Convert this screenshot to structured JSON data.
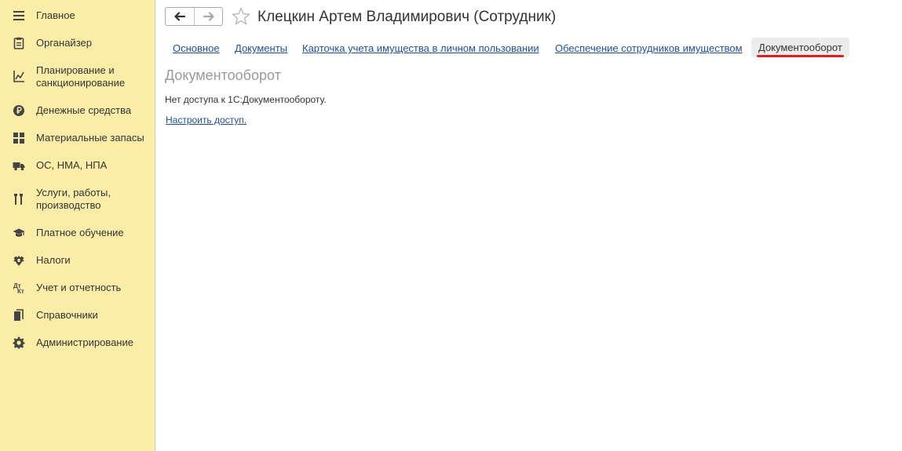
{
  "sidebar": {
    "items": [
      {
        "label": "Главное",
        "icon": "menu-icon"
      },
      {
        "label": "Органайзер",
        "icon": "clipboard-icon"
      },
      {
        "label": "Планирование и санкционирование",
        "icon": "planning-chart-icon"
      },
      {
        "label": "Денежные средства",
        "icon": "ruble-coin-icon"
      },
      {
        "label": "Материальные запасы",
        "icon": "grid-blocks-icon"
      },
      {
        "label": "ОС, НМА, НПА",
        "icon": "truck-icon"
      },
      {
        "label": "Услуги, работы, производство",
        "icon": "tools-icon"
      },
      {
        "label": "Платное обучение",
        "icon": "graduation-cap-icon"
      },
      {
        "label": "Налоги",
        "icon": "emblem-eagle-icon"
      },
      {
        "label": "Учет и отчетность",
        "icon": "debit-credit-icon"
      },
      {
        "label": "Справочники",
        "icon": "books-icon"
      },
      {
        "label": "Администрирование",
        "icon": "gear-icon"
      }
    ]
  },
  "header": {
    "title": "Клецкин Артем Владимирович (Сотрудник)"
  },
  "tabs": [
    {
      "label": "Основное"
    },
    {
      "label": "Документы"
    },
    {
      "label": "Карточка учета имущества в личном пользовании"
    },
    {
      "label": "Обеспечение сотрудников имуществом"
    },
    {
      "label": "Документооборот"
    }
  ],
  "content": {
    "section_title": "Документооборот",
    "message": "Нет доступа к 1С:Документообороту.",
    "setup_link": "Настроить доступ."
  },
  "colors": {
    "sidebar_bg": "#fbeda8",
    "link": "#1f4f9c",
    "active_tab_underline": "#e21e1e"
  }
}
